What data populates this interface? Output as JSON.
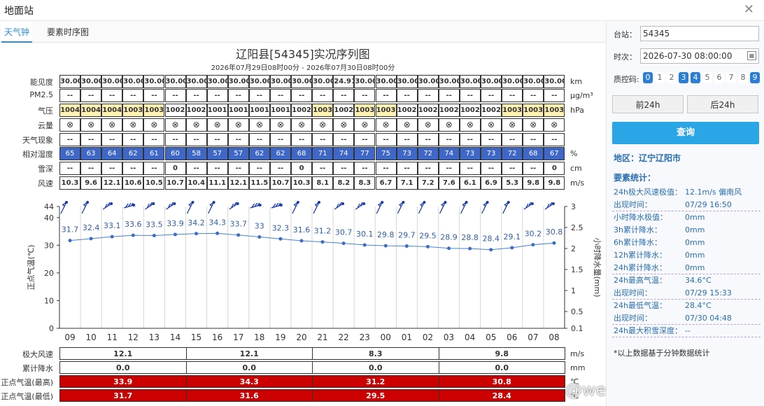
{
  "window": {
    "title": "地面站"
  },
  "tabs": [
    {
      "label": "天气钟"
    },
    {
      "label": "要素时序图"
    }
  ],
  "chart_title": "辽阳县[54345]实况序列图",
  "chart_subtitle": "2026年07月29日08时00分 - 2026年07月30日08时00分",
  "rows": [
    {
      "label": "能见度",
      "unit": "km",
      "values": [
        "30.00",
        "30.00",
        "30.00",
        "30.00",
        "30.00",
        "30.00",
        "30.00",
        "30.00",
        "30.00",
        "30.00",
        "30.00",
        "30.00",
        "30.00",
        "24.91",
        "30.00",
        "30.00",
        "30.00",
        "30.00",
        "30.00",
        "30.00",
        "30.00",
        "30.00",
        "30.00",
        "30.00"
      ]
    },
    {
      "label": "PM2.5",
      "unit": "μg/m³",
      "values": [
        "--",
        "--",
        "--",
        "--",
        "--",
        "--",
        "--",
        "--",
        "--",
        "--",
        "--",
        "--",
        "--",
        "--",
        "--",
        "--",
        "--",
        "--",
        "--",
        "--",
        "--",
        "--",
        "--",
        "--"
      ]
    },
    {
      "label": "气压",
      "unit": "hPa",
      "values": [
        "1004",
        "1004",
        "1004",
        "1003",
        "1003",
        "1002",
        "1002",
        "1001",
        "1001",
        "1001",
        "1001",
        "1002",
        "1003",
        "1002",
        "1003",
        "1003",
        "1002",
        "1002",
        "1002",
        "1002",
        "1002",
        "1003",
        "1003",
        "1003"
      ]
    },
    {
      "label": "云量",
      "unit": "",
      "values": [
        "⊗",
        "⊗",
        "⊗",
        "⊗",
        "⊗",
        "⊗",
        "⊗",
        "⊗",
        "⊗",
        "⊗",
        "⊗",
        "⊗",
        "⊗",
        "⊗",
        "⊗",
        "⊗",
        "⊗",
        "⊗",
        "⊗",
        "⊗",
        "⊗",
        "⊗",
        "⊗",
        "⊗"
      ]
    },
    {
      "label": "天气现象",
      "unit": "",
      "values": [
        "--",
        "--",
        "--",
        "--",
        "--",
        "--",
        "--",
        "--",
        "--",
        "--",
        "--",
        "--",
        "--",
        "--",
        "--",
        "--",
        "--",
        "--",
        "--",
        "--",
        "--",
        "--",
        "--",
        "--"
      ]
    },
    {
      "label": "相对湿度",
      "unit": "%",
      "values": [
        "65",
        "63",
        "64",
        "62",
        "61",
        "60",
        "58",
        "57",
        "57",
        "62",
        "62",
        "68",
        "71",
        "74",
        "77",
        "75",
        "73",
        "72",
        "74",
        "73",
        "73",
        "72",
        "68",
        "67"
      ]
    },
    {
      "label": "雪深",
      "unit": "cm",
      "values": [
        "--",
        "--",
        "--",
        "--",
        "--",
        "0",
        "--",
        "--",
        "--",
        "--",
        "--",
        "0",
        "--",
        "--",
        "--",
        "--",
        "--",
        "--",
        "--",
        "--",
        "--",
        "--",
        "--",
        "0"
      ]
    },
    {
      "label": "风速",
      "unit": "m/s",
      "values": [
        "10.3",
        "9.6",
        "12.1",
        "10.6",
        "10.5",
        "10.7",
        "10.4",
        "11.1",
        "12.1",
        "11.5",
        "10.7",
        "10.3",
        "8.1",
        "8.2",
        "8.3",
        "6.7",
        "7.1",
        "7.2",
        "7.6",
        "6.1",
        "6.9",
        "5.3",
        "9.8",
        "9.8"
      ]
    }
  ],
  "chart_data": {
    "type": "line",
    "categories": [
      "09",
      "10",
      "11",
      "12",
      "13",
      "14",
      "15",
      "16",
      "17",
      "18",
      "19",
      "20",
      "21",
      "22",
      "23",
      "00",
      "01",
      "02",
      "03",
      "04",
      "05",
      "06",
      "07",
      "08"
    ],
    "series": [
      {
        "values": [
          31.7,
          32.4,
          33.1,
          33.6,
          33.5,
          33.9,
          34.2,
          34.3,
          33.7,
          33,
          32.3,
          31.6,
          31.2,
          30.7,
          30.1,
          29.8,
          29.7,
          29.5,
          28.9,
          28.8,
          28.4,
          29.1,
          30.2,
          30.8
        ]
      }
    ],
    "value_labels": [
      "31.7",
      "32.4",
      "33.1",
      "33.6",
      "33.5",
      "33.9",
      "34.2",
      "34.3",
      "33.7",
      "33",
      "32.3",
      "31.6",
      "31.2",
      "30.7",
      "30.1",
      "29.8",
      "29.7",
      "29.5",
      "28.9",
      "28.8",
      "28.4",
      "29.1",
      "30.2",
      "30.8"
    ],
    "ylabel": "正点气温(℃)",
    "y2label": "小时降水量(mm)",
    "ylim": [
      0,
      44
    ],
    "yticks": [
      "0",
      "10",
      "20",
      "30",
      "40",
      "44"
    ],
    "y2lim": [
      0.1,
      3
    ],
    "y2ticks": [
      "0.1",
      "0.5",
      "1",
      "1.5",
      "2",
      "2.5",
      "3"
    ],
    "grid": true
  },
  "stats": [
    {
      "label": "极大风速",
      "unit": "m/s",
      "values": [
        "12.1",
        "12.1",
        "8.3",
        "9.8"
      ],
      "red": false
    },
    {
      "label": "累计降水",
      "unit": "mm",
      "values": [
        "0.0",
        "0.0",
        "0.0",
        "0.0"
      ],
      "red": false
    },
    {
      "label": "正点气温(最高)",
      "unit": "℃",
      "values": [
        "33.9",
        "34.3",
        "31.2",
        "30.8"
      ],
      "red": true
    },
    {
      "label": "正点气温(最低)",
      "unit": "℃",
      "values": [
        "31.7",
        "31.6",
        "29.5",
        "28.4"
      ],
      "red": true
    }
  ],
  "sidebar": {
    "station_label": "台站：",
    "station_value": "54345",
    "time_label": "时次：",
    "time_value": "2026-07-30 08:00:00",
    "qc_label": "质控码:",
    "qc_codes": [
      {
        "n": "0",
        "on": true
      },
      {
        "n": "1",
        "on": false
      },
      {
        "n": "2",
        "on": false
      },
      {
        "n": "3",
        "on": true
      },
      {
        "n": "4",
        "on": true
      },
      {
        "n": "5",
        "on": false
      },
      {
        "n": "6",
        "on": false
      },
      {
        "n": "7",
        "on": false
      },
      {
        "n": "8",
        "on": false
      },
      {
        "n": "9",
        "on": true
      }
    ],
    "prev_label": "前24h",
    "next_label": "后24h",
    "query_label": "查询",
    "region": "地区：辽宁辽阳市",
    "stats_title": "要素统计：",
    "stat_rows": [
      {
        "k": "24h极大风速极值：",
        "v": "12.1m/s 偏南风",
        "dash": false
      },
      {
        "k": "出现时间：",
        "v": "07/29 16:50",
        "dash": true
      },
      {
        "k": "小时降水极值：",
        "v": "0mm",
        "dash": false
      },
      {
        "k": "3h累计降水：",
        "v": "0mm",
        "dash": false
      },
      {
        "k": "6h累计降水：",
        "v": "0mm",
        "dash": false
      },
      {
        "k": "12h累计降水：",
        "v": "0mm",
        "dash": false
      },
      {
        "k": "24h累计降水：",
        "v": "0mm",
        "dash": true
      },
      {
        "k": "24h最高气温：",
        "v": "34.6°C",
        "dash": false
      },
      {
        "k": "出现时间：",
        "v": "07/29 15:33",
        "dash": true
      },
      {
        "k": "24h最低气温：",
        "v": "28.4°C",
        "dash": false
      },
      {
        "k": "出现时间：",
        "v": "07/30 04:48",
        "dash": true
      },
      {
        "k": "24h最大积雪深度：",
        "v": "--",
        "dash": true
      }
    ],
    "note": "*以上数据基于分钟数据统计"
  },
  "watermark": "@weatherman_信欣",
  "colors": {
    "accent": "#2b8fd8",
    "humidity": "#3f67c8",
    "pressure_high": "#fff2b3",
    "temp_red": "#cc0000",
    "line": "#4a7fd0"
  }
}
